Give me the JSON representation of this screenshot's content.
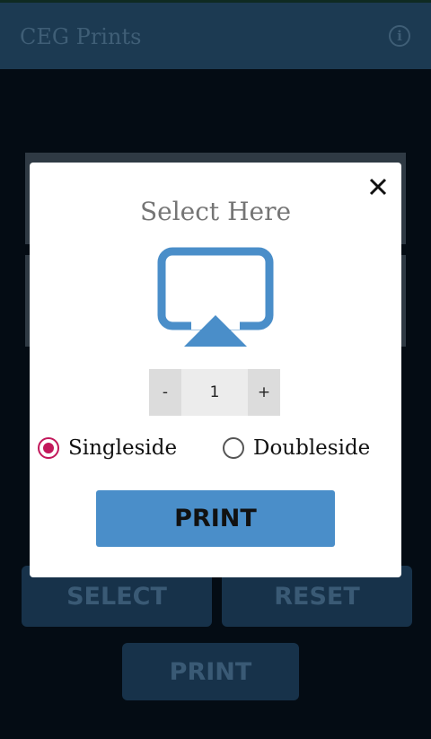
{
  "appbar": {
    "title": "CEG Prints",
    "info_icon": "info-icon"
  },
  "background": {
    "select_label": "SELECT",
    "reset_label": "RESET",
    "print_label": "PRINT"
  },
  "modal": {
    "title": "Select Here",
    "close_icon": "close-icon",
    "print_icon": "airplay-print-icon",
    "stepper": {
      "minus": "-",
      "value": "1",
      "plus": "+"
    },
    "options": [
      {
        "label": "Singleside",
        "checked": true
      },
      {
        "label": "Doubleside",
        "checked": false
      }
    ],
    "print_label": "PRINT"
  },
  "colors": {
    "appbar": "#1c3a52",
    "accent_radio": "#c2185b",
    "print_button": "#4a8ec9"
  }
}
